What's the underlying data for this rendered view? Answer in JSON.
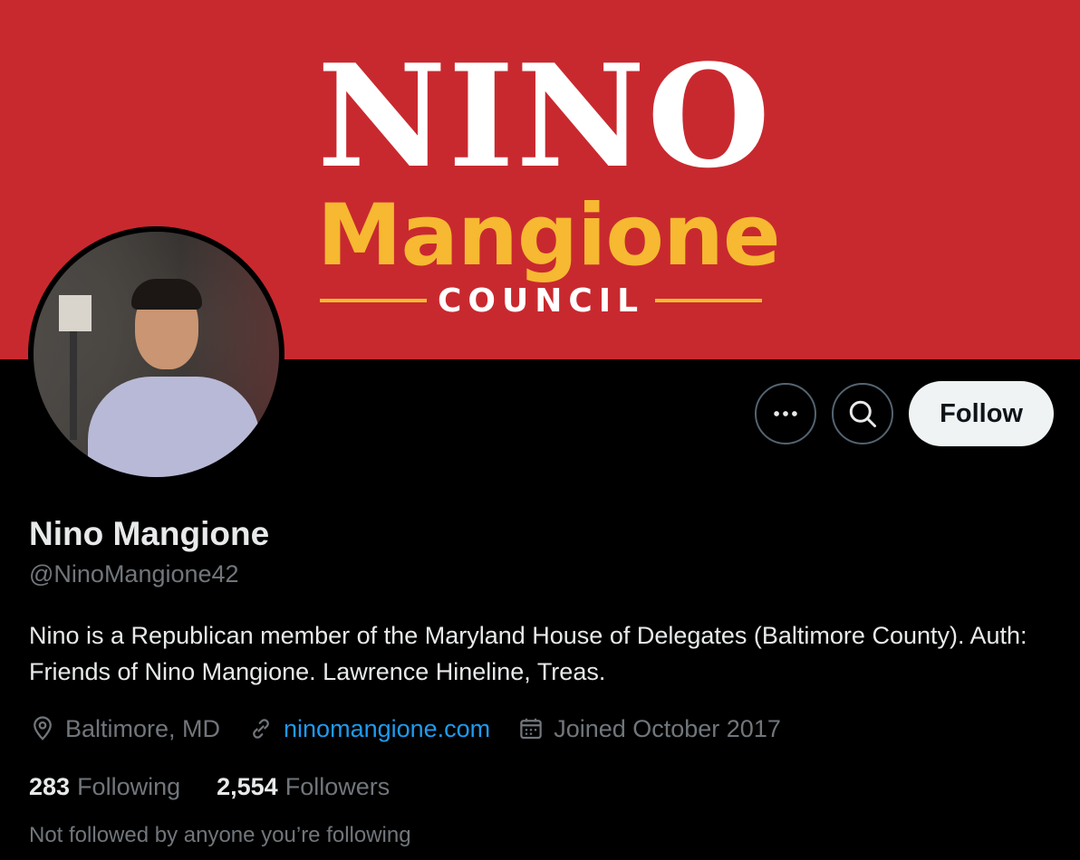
{
  "banner": {
    "line1": "NINO",
    "line2": "Mangione",
    "line3": "COUNCIL"
  },
  "actions": {
    "more_icon": "more-icon",
    "search_icon": "search-icon",
    "follow_label": "Follow"
  },
  "profile": {
    "name": "Nino Mangione",
    "handle": "@NinoMangione42",
    "bio": "Nino is a Republican member of the Maryland House of Delegates (Baltimore County). Auth: Friends of Nino Mangione. Lawrence Hineline, Treas.",
    "location": "Baltimore, MD",
    "website": "ninomangione.com",
    "joined": "Joined October 2017"
  },
  "stats": {
    "following_count": "283",
    "following_label": "Following",
    "followers_count": "2,554",
    "followers_label": "Followers"
  },
  "notice": "Not followed by anyone you’re following",
  "colors": {
    "banner_red": "#c8292f",
    "banner_yellow": "#f6b931",
    "link_blue": "#1d9bf0",
    "muted_text": "#71767b"
  }
}
